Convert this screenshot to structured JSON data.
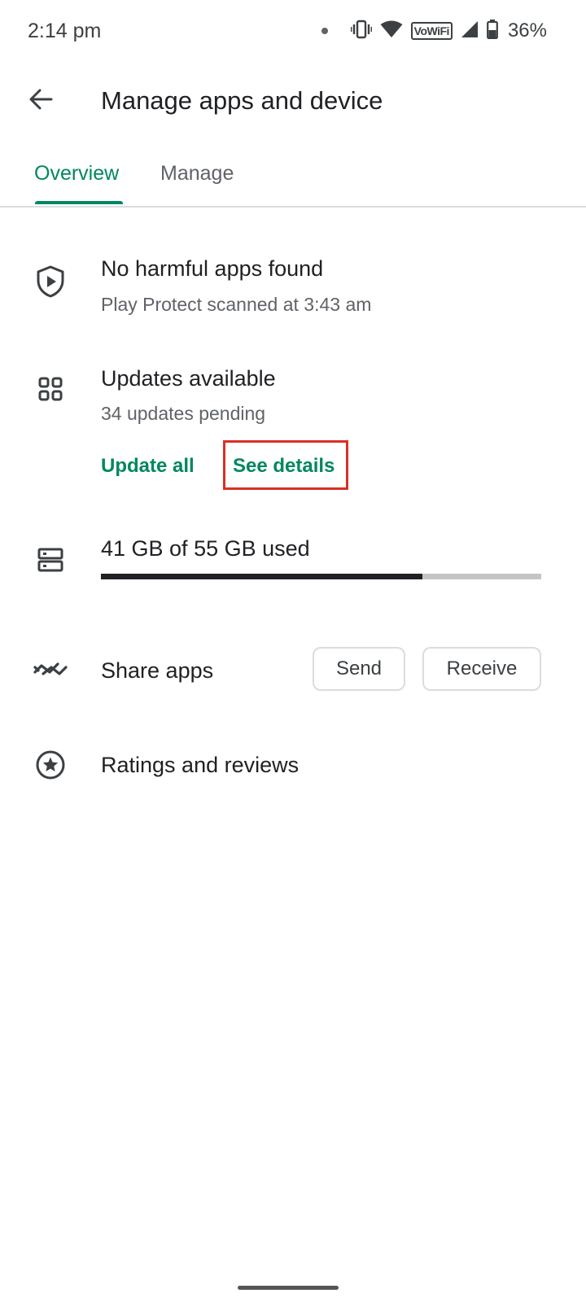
{
  "status_bar": {
    "time": "2:14 pm",
    "network_label": "VoWiFi",
    "battery_percent": "36%",
    "icons": [
      "notification-dot-icon",
      "vibrate-icon",
      "wifi-icon",
      "vowifi-icon",
      "cell-signal-icon",
      "battery-icon"
    ]
  },
  "header": {
    "title": "Manage apps and device",
    "back_icon": "arrow-back-icon"
  },
  "tabs": [
    {
      "label": "Overview",
      "selected": true
    },
    {
      "label": "Manage",
      "selected": false
    }
  ],
  "colors": {
    "accent": "#01875f",
    "highlight": "#d93025",
    "text_primary": "#202124",
    "text_secondary": "#5f6368"
  },
  "protect": {
    "icon": "shield-play-icon",
    "title": "No harmful apps found",
    "subtitle": "Play Protect scanned at 3:43 am"
  },
  "updates": {
    "icon": "apps-grid-icon",
    "title": "Updates available",
    "subtitle": "34 updates pending",
    "update_all_label": "Update all",
    "see_details_label": "See details"
  },
  "storage": {
    "icon": "storage-icon",
    "label": "41 GB of 55 GB used",
    "used_fraction": 0.73
  },
  "share": {
    "icon": "share-apps-icon",
    "label": "Share apps",
    "send_label": "Send",
    "receive_label": "Receive"
  },
  "ratings": {
    "icon": "star-circle-icon",
    "label": "Ratings and reviews"
  }
}
